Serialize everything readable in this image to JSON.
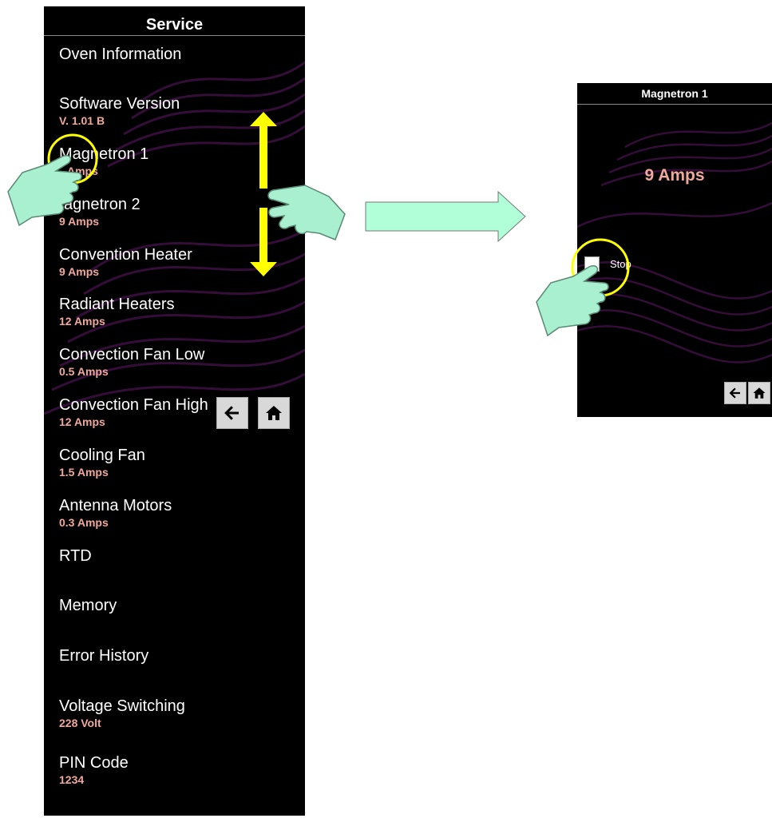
{
  "service": {
    "header": "Service",
    "items": [
      {
        "label": "Oven Information",
        "value": ""
      },
      {
        "label": "Software Version",
        "value": "V. 1.01 B"
      },
      {
        "label": "Magnetron 1",
        "value": "Amps"
      },
      {
        "label": "agnetron 2",
        "value": "9 Amps"
      },
      {
        "label": "Convention Heater",
        "value": "9 Amps"
      },
      {
        "label": "Radiant Heaters",
        "value": "12 Amps"
      },
      {
        "label": "Convection Fan Low",
        "value": "0.5 Amps"
      },
      {
        "label": "Convection Fan High",
        "value": "12 Amps"
      },
      {
        "label": "Cooling Fan",
        "value": "1.5 Amps"
      },
      {
        "label": "Antenna Motors",
        "value": "0.3 Amps"
      },
      {
        "label": "RTD",
        "value": ""
      },
      {
        "label": "Memory",
        "value": ""
      },
      {
        "label": "Error History",
        "value": ""
      },
      {
        "label": "Voltage Switching",
        "value": "228 Volt"
      },
      {
        "label": "PIN Code",
        "value": "1234"
      }
    ],
    "back_icon": "arrow-left-icon",
    "home_icon": "home-icon"
  },
  "magnetron": {
    "header": "Magnetron 1",
    "value": "9 Amps",
    "stop_label": "Stop",
    "back_icon": "arrow-left-icon",
    "home_icon": "home-icon"
  },
  "colors": {
    "panel_bg": "#000000",
    "value_text": "#f0a89c",
    "highlight": "#ffff00",
    "hand": "#a8f0d0",
    "arrow_fill": "#b0ffd8"
  }
}
